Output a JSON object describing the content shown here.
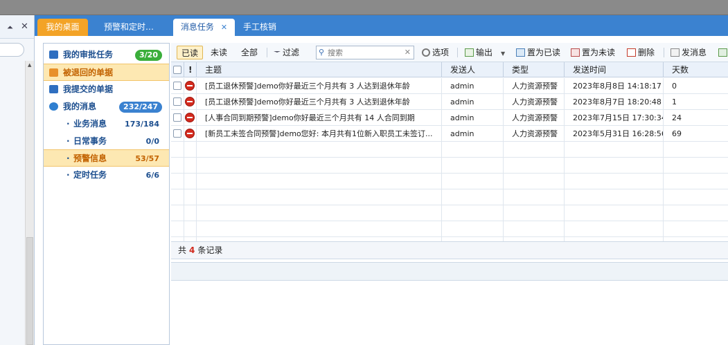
{
  "tabs": [
    {
      "label": "我的桌面"
    },
    {
      "label": "预警和定时…"
    },
    {
      "label": "消息任务",
      "close": "✕"
    },
    {
      "label": "手工核销"
    }
  ],
  "left_panel": {
    "pin_icon": "pin-icon",
    "close_icon": "close-icon"
  },
  "nav": [
    {
      "label": "我的审批任务",
      "count": "3/20",
      "count_color": "#3aae3a"
    },
    {
      "label": "被退回的单据",
      "selected": true
    },
    {
      "label": "我提交的单据"
    },
    {
      "label": "我的消息",
      "count": "232/247",
      "count_color": "#3b82d0"
    }
  ],
  "sub_nav": [
    {
      "label": "业务消息",
      "count": "173/184"
    },
    {
      "label": "日常事务",
      "count": "0/0"
    },
    {
      "label": "预警信息",
      "count": "53/57",
      "selected": true
    },
    {
      "label": "定时任务",
      "count": "6/6"
    }
  ],
  "toolbar": {
    "read": "已读",
    "unread": "未读",
    "all": "全部",
    "filter": "过滤",
    "search_placeholder": "搜索",
    "options": "选项",
    "export": "输出",
    "mark_read": "置为已读",
    "mark_unread": "置为未读",
    "delete": "删除",
    "send": "发消息"
  },
  "grid": {
    "headers": {
      "mark": "!",
      "subject": "主题",
      "sender": "发送人",
      "type": "类型",
      "time": "发送时间",
      "days": "天数"
    },
    "rows": [
      {
        "subject": "[员工退休预警]demo你好最近三个月共有 3 人达到退休年龄",
        "sender": "admin",
        "type": "人力资源预警",
        "time": "2023年8月8日 14:18:17",
        "days": "0"
      },
      {
        "subject": "[员工退休预警]demo你好最近三个月共有 3 人达到退休年龄",
        "sender": "admin",
        "type": "人力资源预警",
        "time": "2023年8月7日 18:20:48",
        "days": "1"
      },
      {
        "subject": "[人事合同到期预警]demo你好最近三个月共有 14 人合同到期",
        "sender": "admin",
        "type": "人力资源预警",
        "time": "2023年7月15日 17:30:34",
        "days": "24"
      },
      {
        "subject": "[新员工未签合同预警]demo您好: 本月共有1位新入职员工未签订...",
        "sender": "admin",
        "type": "人力资源预警",
        "time": "2023年5月31日 16:28:56",
        "days": "69"
      }
    ]
  },
  "footer": {
    "prefix": "共",
    "count": "4",
    "suffix": "条记录"
  }
}
